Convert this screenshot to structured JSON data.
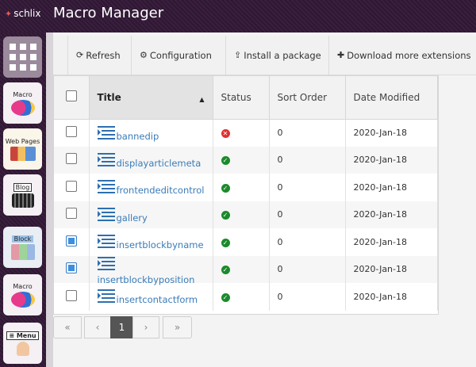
{
  "brand": {
    "name": "schlix"
  },
  "header": {
    "title": "Macro Manager"
  },
  "sidebar": {
    "items": [
      {
        "name": "apps-grid",
        "label": ""
      },
      {
        "name": "macro",
        "label": "Macro"
      },
      {
        "name": "web-pages",
        "label": "Web Pages"
      },
      {
        "name": "blog",
        "label": "Blog"
      },
      {
        "name": "block",
        "label": "Block"
      },
      {
        "name": "macro-2",
        "label": "Macro"
      },
      {
        "name": "menu",
        "label": "≡ Menu"
      }
    ]
  },
  "toolbar": {
    "refresh": "Refresh",
    "configuration": "Configuration",
    "install": "Install a package",
    "download": "Download more extensions"
  },
  "table": {
    "columns": {
      "title": "Title",
      "status": "Status",
      "sort_order": "Sort Order",
      "date_modified": "Date Modified"
    },
    "rows": [
      {
        "title": "bannedip",
        "status": "error",
        "sort_order": "0",
        "date": "2020-Jan-18",
        "checked": false
      },
      {
        "title": "displayarticlemeta",
        "status": "ok",
        "sort_order": "0",
        "date": "2020-Jan-18",
        "checked": false
      },
      {
        "title": "frontendeditcontrol",
        "status": "ok",
        "sort_order": "0",
        "date": "2020-Jan-18",
        "checked": false
      },
      {
        "title": "gallery",
        "status": "ok",
        "sort_order": "0",
        "date": "2020-Jan-18",
        "checked": false
      },
      {
        "title": "insertblockbyname",
        "status": "ok",
        "sort_order": "0",
        "date": "2020-Jan-18",
        "checked": true
      },
      {
        "title": "insertblockbyposition",
        "status": "ok",
        "sort_order": "0",
        "date": "2020-Jan-18",
        "checked": true
      },
      {
        "title": "insertcontactform",
        "status": "ok",
        "sort_order": "0",
        "date": "2020-Jan-18",
        "checked": false
      }
    ]
  },
  "pagination": {
    "first": "«",
    "prev": "‹",
    "current": "1",
    "next": "›",
    "last": "»"
  },
  "colors": {
    "link": "#3a7cb8",
    "ok": "#1b8a2b",
    "error": "#e23030",
    "header_bg": "#2e1832"
  }
}
